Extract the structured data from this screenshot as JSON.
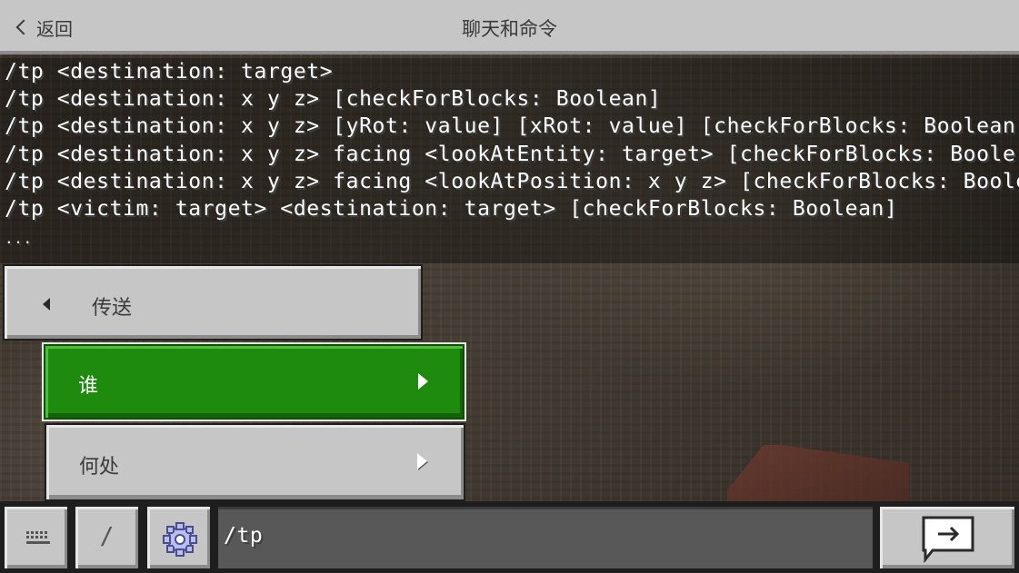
{
  "header": {
    "back_label": "返回",
    "title": "聊天和命令"
  },
  "chat": {
    "lines": [
      "/tp <destination: target>",
      "/tp <destination: x y z> [checkForBlocks: Boolean]",
      "/tp <destination: x y z> [yRot: value] [xRot: value] [checkForBlocks: Boolean",
      "/tp <destination: x y z> facing <lookAtEntity: target> [checkForBlocks: Boole",
      "/tp <destination: x y z> facing <lookAtPosition: x y z> [checkForBlocks: Boole",
      "/tp <victim: target> <destination: target> [checkForBlocks: Boolean]",
      "..."
    ]
  },
  "suggestions": {
    "category_label": "传送",
    "options": [
      {
        "label": "谁",
        "selected": true
      },
      {
        "label": "何处",
        "selected": false
      }
    ]
  },
  "input": {
    "value": "/tp"
  },
  "toolbar": {
    "slash_label": "/",
    "keyboard_icon": "keyboard-icon",
    "settings_icon": "gear-icon",
    "send_icon": "send-icon"
  },
  "colors": {
    "panel_gray": "#c6c6c6",
    "selected_green": "#1e8a0e",
    "input_bg": "#585858"
  }
}
